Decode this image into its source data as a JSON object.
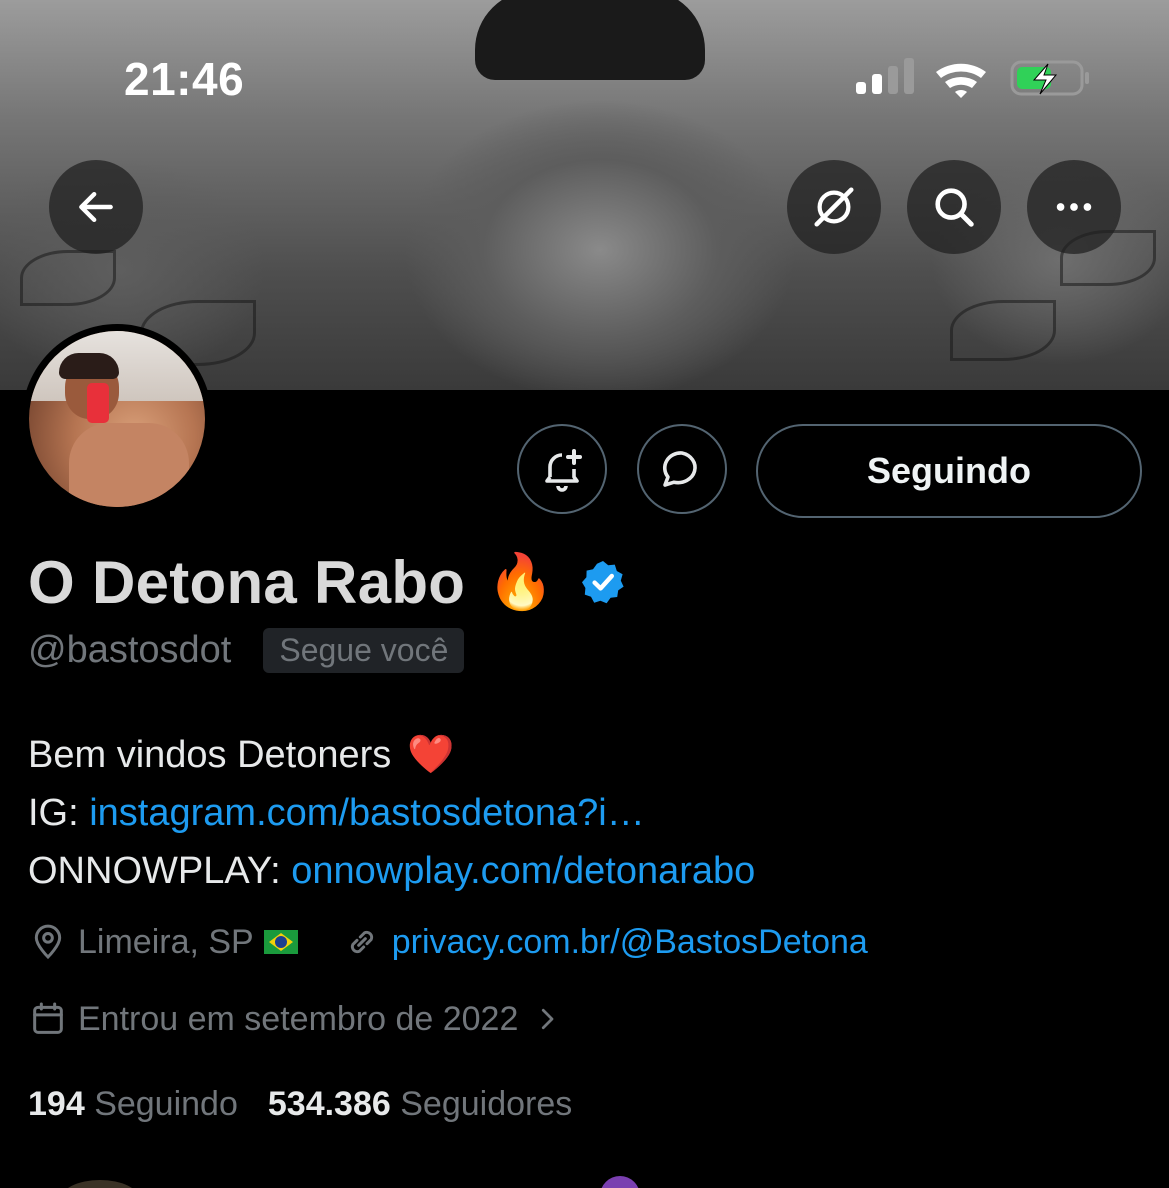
{
  "status_bar": {
    "time": "21:46"
  },
  "header": {
    "back_icon": "arrow-left-icon",
    "action_icons": [
      "grok-icon",
      "search-icon",
      "more-icon"
    ]
  },
  "profile": {
    "display_name": "O Detona Rabo",
    "name_emoji": "🔥",
    "verified": true,
    "handle": "@bastosdot",
    "follows_you_badge": "Segue você",
    "follow_button_label": "Seguindo",
    "bio": {
      "line1": "Bem vindos Detoners",
      "line1_emoji": "❤️",
      "line2_prefix": "IG: ",
      "line2_link": "instagram.com/bastosdetona?i…",
      "line3_prefix": "ONNOWPLAY: ",
      "line3_link": "onnowplay.com/detonarabo"
    },
    "location": "Limeira, SP",
    "website": "privacy.com.br/@BastosDetona",
    "joined": "Entrou em setembro de 2022",
    "following_count": "194",
    "following_label": "Seguindo",
    "followers_count": "534.386",
    "followers_label": "Seguidores"
  },
  "colors": {
    "accent": "#1d9bf0",
    "muted": "#71767b",
    "border": "#536471",
    "background": "#000000"
  }
}
